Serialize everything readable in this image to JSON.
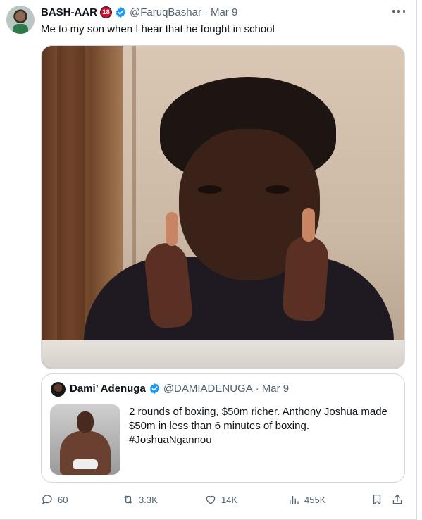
{
  "tweet": {
    "author_name": "BASH-AAR",
    "age_badge": "18",
    "handle": "@FaruqBashar",
    "separator": "·",
    "date": "Mar 9",
    "text": "Me to my son when I hear that he fought in school"
  },
  "quoted": {
    "author_name": "Dami’ Adenuga",
    "handle": "@DAMIADENUGA",
    "separator": "·",
    "date": "Mar 9",
    "text_lines": [
      "2 rounds of boxing, $50m richer. Anthony Joshua made",
      "$50m in less than 6 minutes of boxing.",
      "#JoshuaNgannou"
    ]
  },
  "actions": {
    "replies": "60",
    "reposts": "3.3K",
    "likes": "14K",
    "views": "455K"
  },
  "colors": {
    "text": "#0f1419",
    "secondary": "#536471",
    "verified": "#1d9bf0",
    "border": "#cfd9de",
    "age_badge": "#c8102e"
  },
  "icons": [
    "more-icon",
    "verified-icon",
    "reply-icon",
    "repost-icon",
    "like-icon",
    "views-icon",
    "bookmark-icon",
    "share-icon"
  ]
}
